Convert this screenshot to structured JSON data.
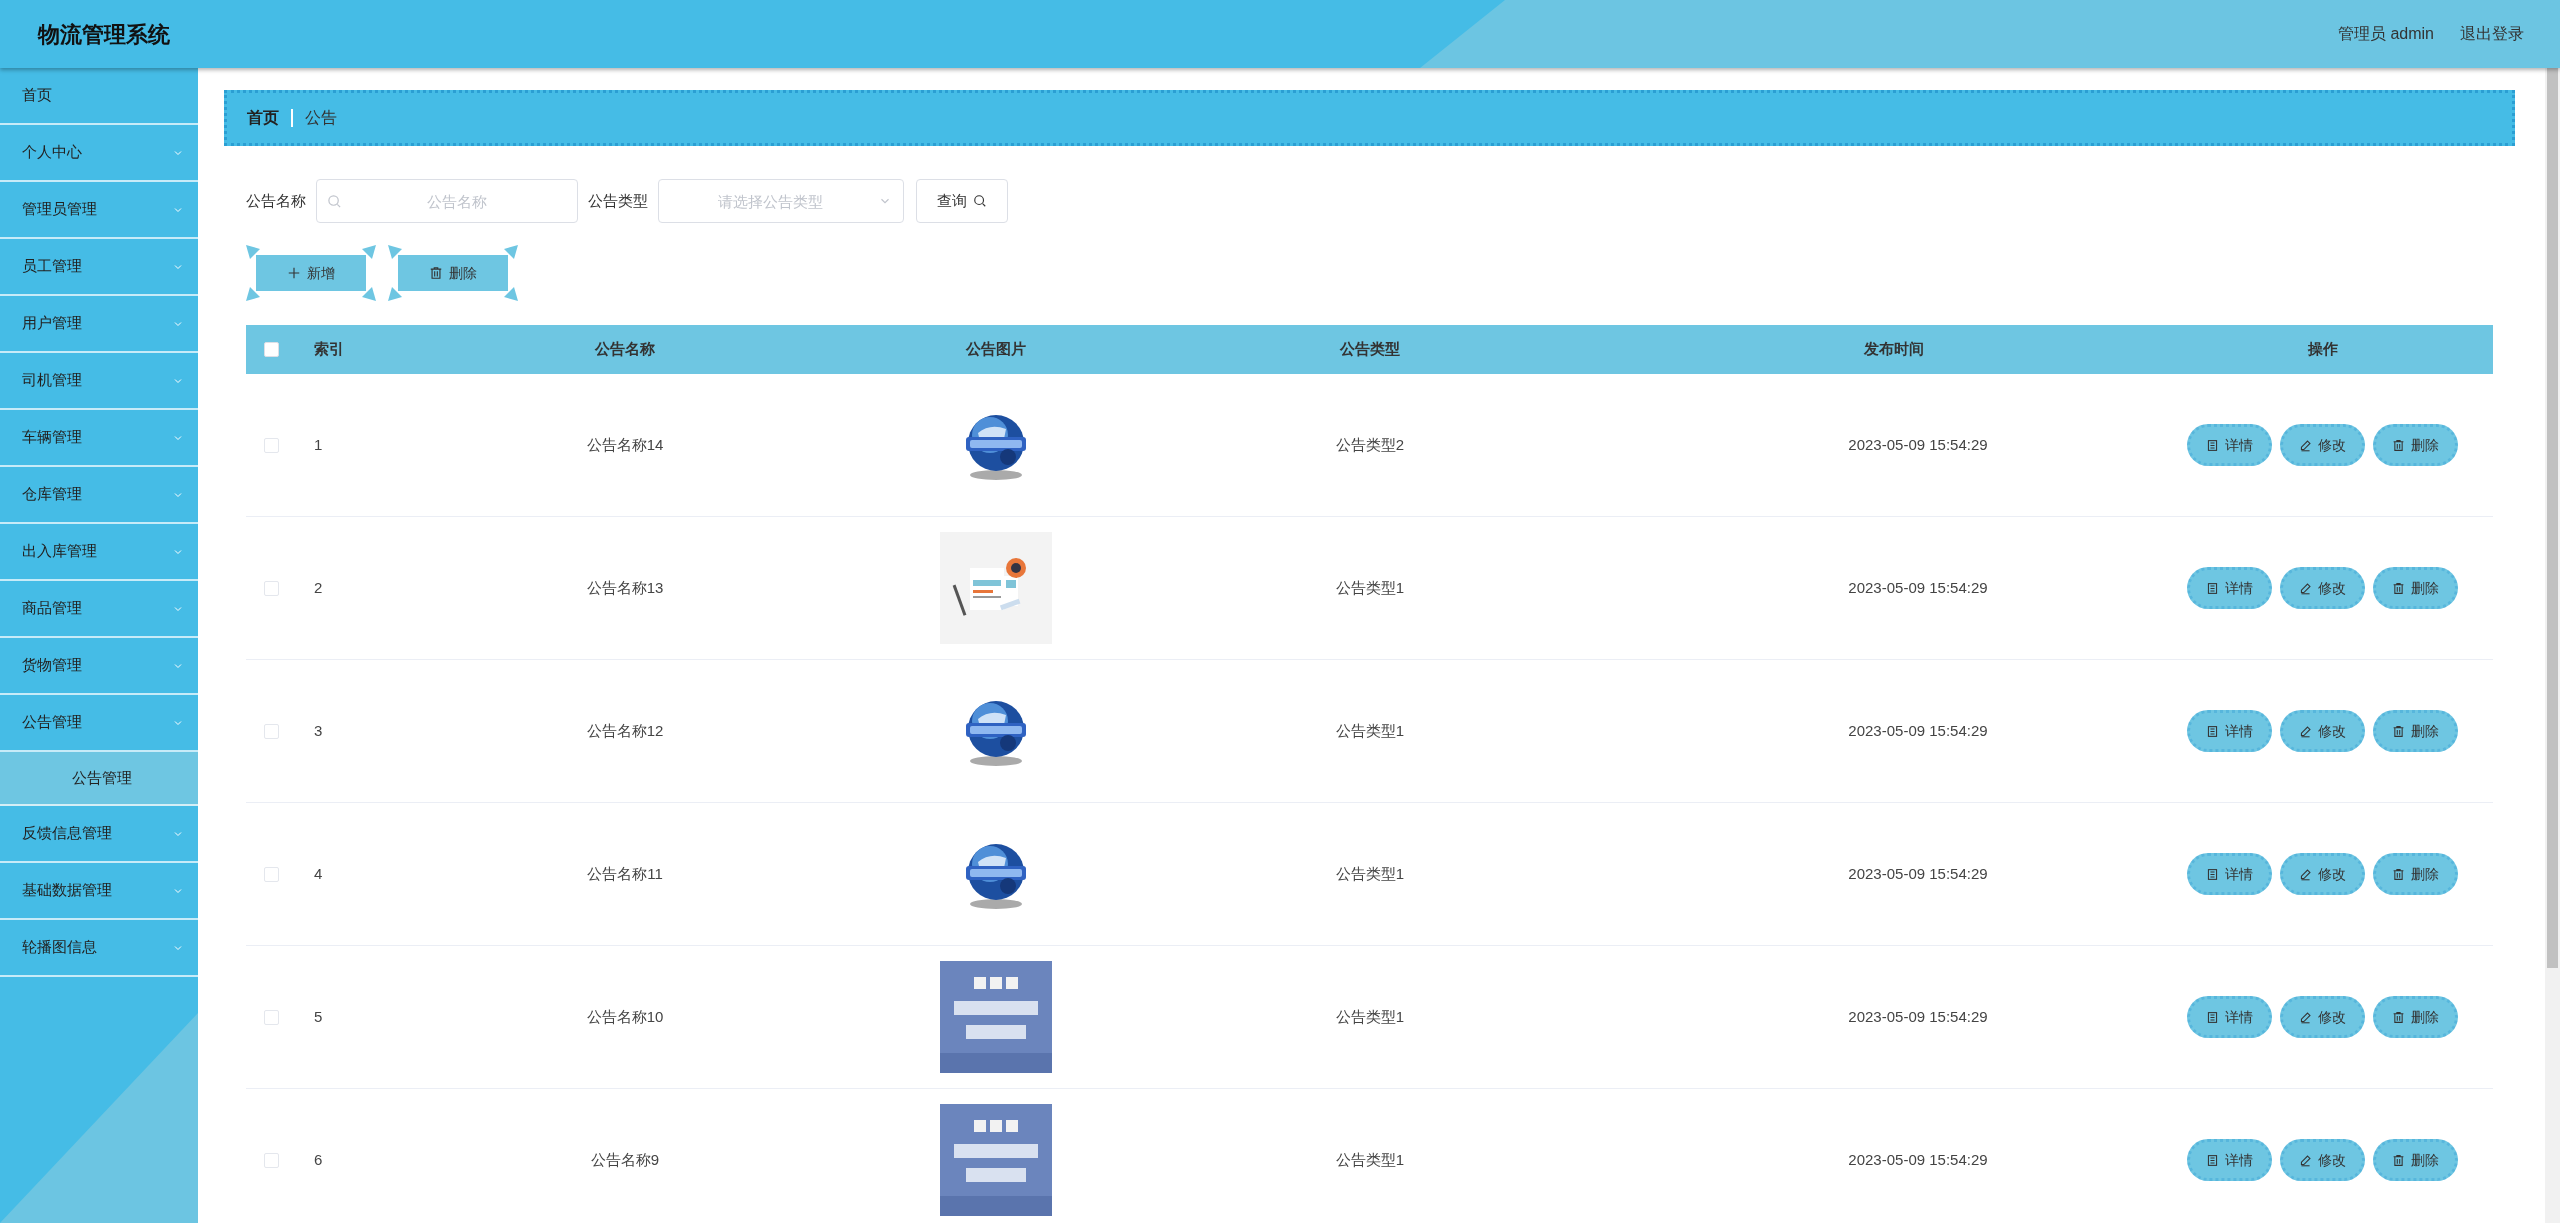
{
  "header": {
    "title": "物流管理系统",
    "user": "管理员 admin",
    "logout": "退出登录"
  },
  "sidebar": {
    "items": [
      {
        "label": "首页",
        "kind": "link"
      },
      {
        "label": "个人中心",
        "kind": "menu"
      },
      {
        "label": "管理员管理",
        "kind": "menu"
      },
      {
        "label": "员工管理",
        "kind": "menu"
      },
      {
        "label": "用户管理",
        "kind": "menu"
      },
      {
        "label": "司机管理",
        "kind": "menu"
      },
      {
        "label": "车辆管理",
        "kind": "menu"
      },
      {
        "label": "仓库管理",
        "kind": "menu"
      },
      {
        "label": "出入库管理",
        "kind": "menu"
      },
      {
        "label": "商品管理",
        "kind": "menu"
      },
      {
        "label": "货物管理",
        "kind": "menu"
      },
      {
        "label": "公告管理",
        "kind": "menu",
        "children": [
          {
            "label": "公告管理",
            "selected": true
          }
        ]
      },
      {
        "label": "反馈信息管理",
        "kind": "menu"
      },
      {
        "label": "基础数据管理",
        "kind": "menu"
      },
      {
        "label": "轮播图信息",
        "kind": "menu"
      }
    ]
  },
  "breadcrumb": [
    "首页",
    "公告"
  ],
  "search": {
    "fields": [
      {
        "label": "公告名称",
        "kind": "text",
        "placeholder": "公告名称"
      },
      {
        "label": "公告类型",
        "kind": "select",
        "placeholder": "请选择公告类型"
      }
    ],
    "button": "查询"
  },
  "actions": [
    {
      "label": "新增",
      "kind": "add"
    },
    {
      "label": "删除",
      "kind": "delete"
    }
  ],
  "table": {
    "select_all": {
      "checked": false
    },
    "columns": [
      "索引",
      "公告名称",
      "公告图片",
      "公告类型",
      "发布时间",
      "操作"
    ],
    "rows": [
      {
        "checked": false,
        "index": "1",
        "name": "公告名称14",
        "type": "公告类型2",
        "time": "2023-05-09 15:54:29",
        "actions": [
          {
            "label": "详情",
            "kind": "detail"
          },
          {
            "label": "修改",
            "kind": "edit"
          },
          {
            "label": "删除",
            "kind": "delete"
          }
        ]
      },
      {
        "checked": false,
        "index": "2",
        "name": "公告名称13",
        "type": "公告类型1",
        "time": "2023-05-09 15:54:29",
        "actions": [
          {
            "label": "详情",
            "kind": "detail"
          },
          {
            "label": "修改",
            "kind": "edit"
          },
          {
            "label": "删除",
            "kind": "delete"
          }
        ]
      },
      {
        "checked": false,
        "index": "3",
        "name": "公告名称12",
        "type": "公告类型1",
        "time": "2023-05-09 15:54:29",
        "actions": [
          {
            "label": "详情",
            "kind": "detail"
          },
          {
            "label": "修改",
            "kind": "edit"
          },
          {
            "label": "删除",
            "kind": "delete"
          }
        ]
      },
      {
        "checked": false,
        "index": "4",
        "name": "公告名称11",
        "type": "公告类型1",
        "time": "2023-05-09 15:54:29",
        "actions": [
          {
            "label": "详情",
            "kind": "detail"
          },
          {
            "label": "修改",
            "kind": "edit"
          },
          {
            "label": "删除",
            "kind": "delete"
          }
        ]
      },
      {
        "checked": false,
        "index": "5",
        "name": "公告名称10",
        "type": "公告类型1",
        "time": "2023-05-09 15:54:29",
        "actions": [
          {
            "label": "详情",
            "kind": "detail"
          },
          {
            "label": "修改",
            "kind": "edit"
          },
          {
            "label": "删除",
            "kind": "delete"
          }
        ]
      },
      {
        "checked": false,
        "index": "6",
        "name": "公告名称9",
        "type": "公告类型1",
        "time": "2023-05-09 15:54:29",
        "actions": [
          {
            "label": "详情",
            "kind": "detail"
          },
          {
            "label": "修改",
            "kind": "edit"
          },
          {
            "label": "删除",
            "kind": "delete"
          }
        ]
      }
    ]
  }
}
